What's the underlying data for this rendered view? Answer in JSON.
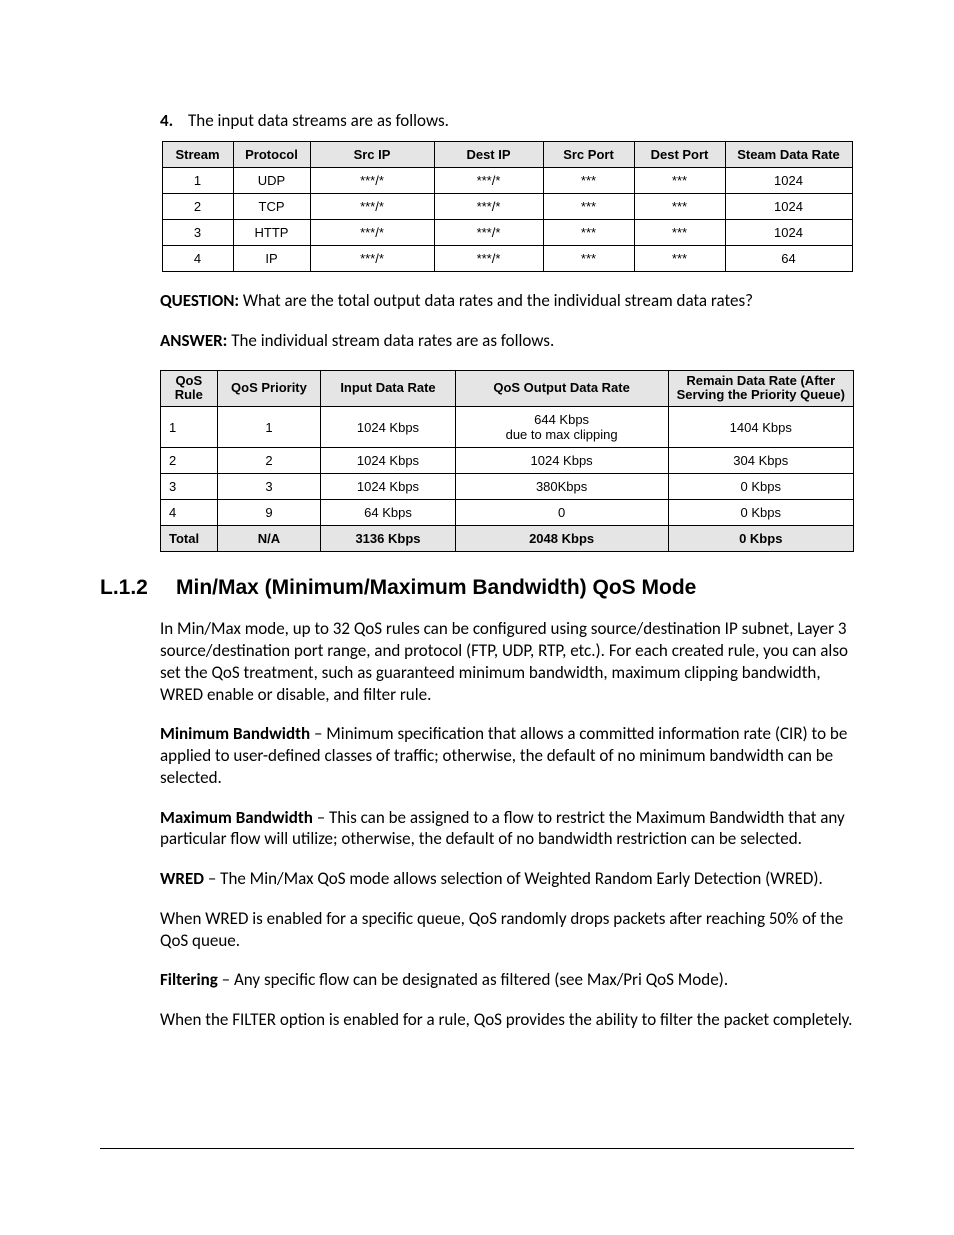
{
  "list_item": {
    "number": "4.",
    "text": "The input data streams are as follows."
  },
  "table1": {
    "headers": [
      "Stream",
      "Protocol",
      "Src IP",
      "Dest IP",
      "Src Port",
      "Dest Port",
      "Steam Data Rate"
    ],
    "rows": [
      [
        "1",
        "UDP",
        "***/*",
        "***/*",
        "***",
        "***",
        "1024"
      ],
      [
        "2",
        "TCP",
        "***/*",
        "***/*",
        "***",
        "***",
        "1024"
      ],
      [
        "3",
        "HTTP",
        "***/*",
        "***/*",
        "***",
        "***",
        "1024"
      ],
      [
        "4",
        "IP",
        "***/*",
        "***/*",
        "***",
        "***",
        "64"
      ]
    ]
  },
  "question_label": "QUESTION:",
  "question_text": " What are the total output data rates and the individual stream data rates?",
  "answer_label": "ANSWER:",
  "answer_text": " The individual stream data rates are as follows.",
  "table2": {
    "headers": [
      "QoS Rule",
      "QoS Priority",
      "Input Data Rate",
      "QoS Output Data Rate",
      "Remain Data Rate (After Serving the Priority Queue)"
    ],
    "rows": [
      [
        "1",
        "1",
        "1024 Kbps",
        "644 Kbps\ndue to max clipping",
        "1404 Kbps"
      ],
      [
        "2",
        "2",
        "1024 Kbps",
        "1024 Kbps",
        "304 Kbps"
      ],
      [
        "3",
        "3",
        "1024 Kbps",
        "380Kbps",
        "0 Kbps"
      ],
      [
        "4",
        "9",
        "64 Kbps",
        "0",
        "0 Kbps"
      ]
    ],
    "total_row": [
      "Total",
      "N/A",
      "3136 Kbps",
      "2048 Kbps",
      "0 Kbps"
    ]
  },
  "section": {
    "number": "L.1.2",
    "title": "Min/Max (Minimum/Maximum Bandwidth) QoS Mode"
  },
  "body": {
    "p1": "In Min/Max mode, up to 32 QoS rules can be configured using source/destination IP subnet, Layer 3 source/destination port range, and protocol (FTP, UDP, RTP, etc.). For each created rule, you can also set the QoS treatment, such as guaranteed minimum bandwidth, maximum clipping bandwidth, WRED enable or disable, and filter rule.",
    "d1_label": "Minimum Bandwidth",
    "d1_text": " – Minimum specification that allows a committed information rate (CIR) to be applied to user-defined classes of traffic; otherwise, the default of no minimum bandwidth can be selected.",
    "d2_label": "Maximum Bandwidth",
    "d2_text": " – This can be assigned to a flow to restrict the Maximum Bandwidth that any particular flow will utilize; otherwise, the default of no bandwidth restriction can be selected.",
    "d3_label": "WRED",
    "d3_text": " – The Min/Max QoS mode allows selection of Weighted Random Early Detection (WRED).",
    "p2": "When WRED is enabled for a specific queue, QoS randomly drops packets after reaching 50% of the QoS queue.",
    "d4_label": "Filtering",
    "d4_text": " – Any specific flow can be designated as filtered (see Max/Pri QoS Mode).",
    "p3": "When the FILTER option is enabled for a rule,  QoS provides the ability to filter the packet completely."
  }
}
